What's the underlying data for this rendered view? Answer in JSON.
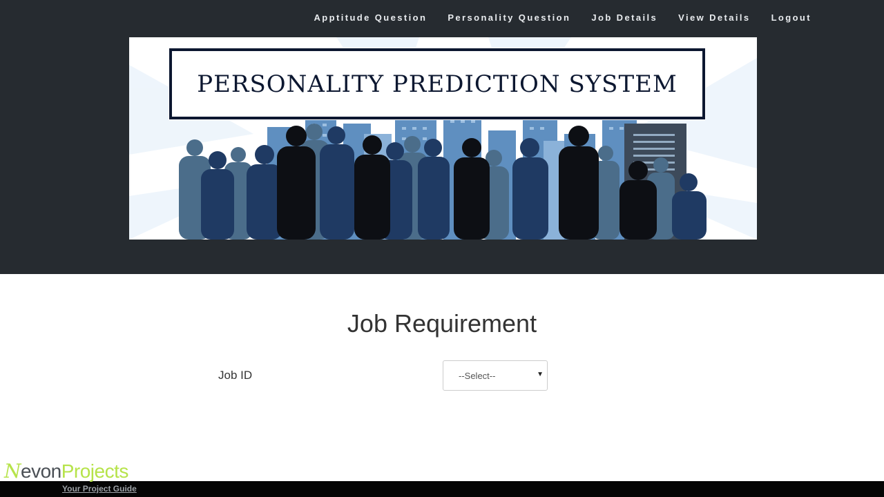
{
  "nav": {
    "items": [
      {
        "label": "Apptitude Question"
      },
      {
        "label": "Personality Question"
      },
      {
        "label": "Job Details"
      },
      {
        "label": "View Details"
      },
      {
        "label": "Logout"
      }
    ]
  },
  "banner": {
    "title": "PERSONALITY PREDICTION SYSTEM"
  },
  "main": {
    "title": "Job Requirement",
    "job_id_label": "Job ID",
    "job_id_select": {
      "selected": "--Select--"
    }
  },
  "watermark": {
    "logo_part1": "N",
    "logo_part2": "evon",
    "logo_part3": "Projects",
    "tagline": "Your Project Guide"
  },
  "colors": {
    "header_bg": "#262b30",
    "banner_title": "#0c1730",
    "logo_green": "#b6e34a"
  }
}
